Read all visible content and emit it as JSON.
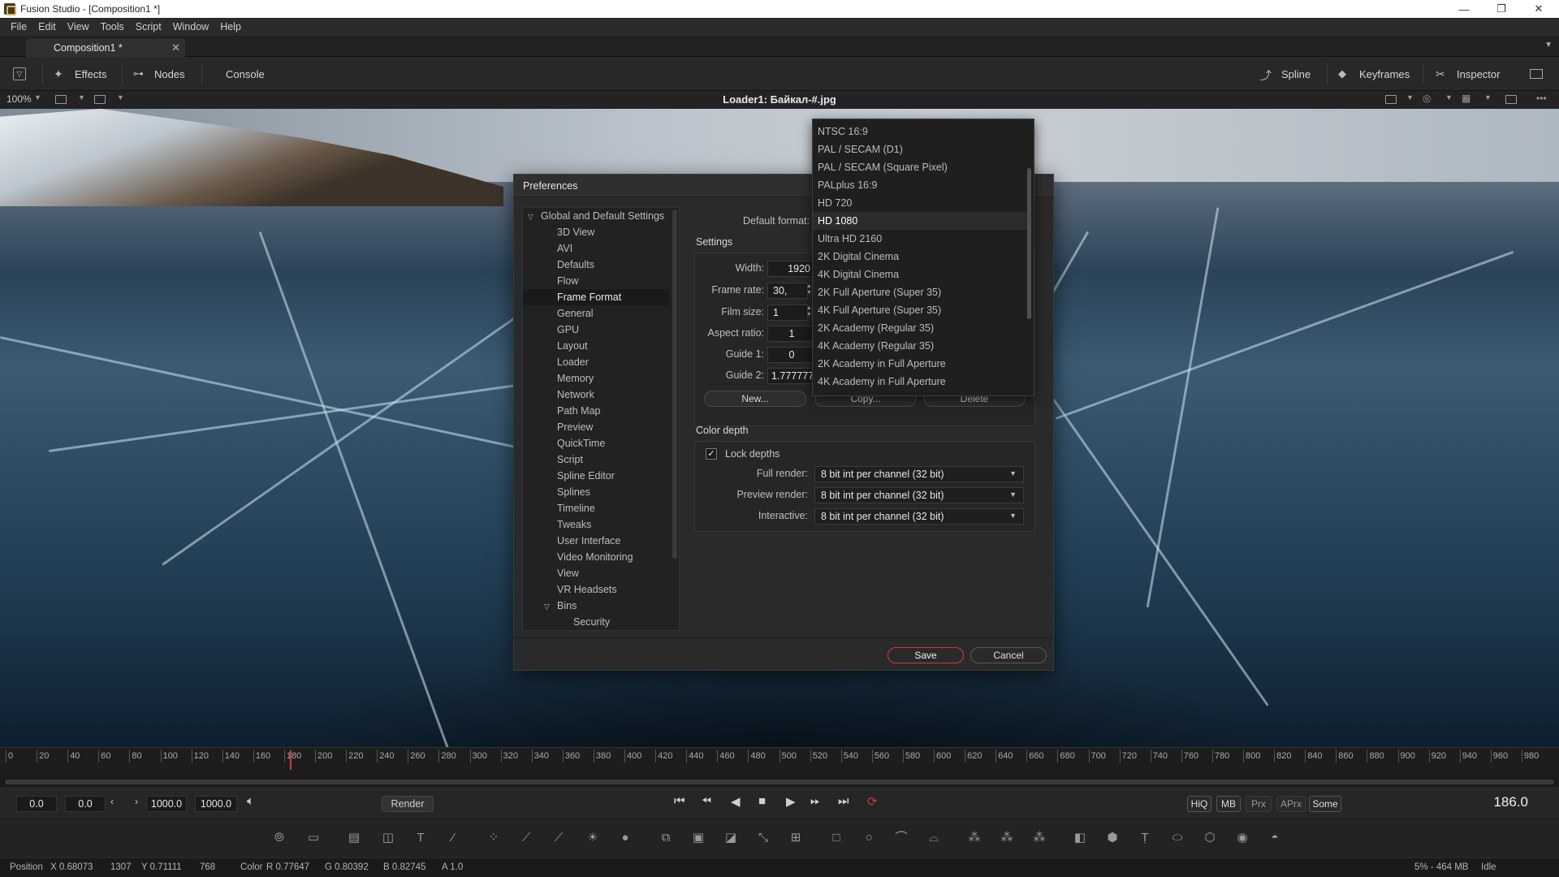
{
  "window": {
    "title": "Fusion Studio - [Composition1 *]",
    "minimize": "—",
    "maximize": "❐",
    "close": "✕"
  },
  "menu": [
    "File",
    "Edit",
    "View",
    "Tools",
    "Script",
    "Window",
    "Help"
  ],
  "tab": {
    "label": "Composition1 *",
    "close": "✕"
  },
  "toolbar": {
    "effects": "Effects",
    "nodes": "Nodes",
    "console": "Console",
    "spline": "Spline",
    "keyframes": "Keyframes",
    "inspector": "Inspector"
  },
  "viewer": {
    "zoom": "100%",
    "title": "Loader1: Байкал-#.jpg"
  },
  "dialog": {
    "title": "Preferences",
    "tree": {
      "root": "Global and Default Settings",
      "items": [
        "3D View",
        "AVI",
        "Defaults",
        "Flow",
        "Frame Format",
        "General",
        "GPU",
        "Layout",
        "Loader",
        "Memory",
        "Network",
        "Path Map",
        "Preview",
        "QuickTime",
        "Script",
        "Spline Editor",
        "Splines",
        "Timeline",
        "Tweaks",
        "User Interface",
        "Video Monitoring",
        "View",
        "VR Headsets"
      ],
      "selected": "Frame Format",
      "bins": "Bins",
      "bins_items": [
        "Security"
      ]
    },
    "default_format_label": "Default format:",
    "settings_label": "Settings",
    "width_label": "Width:",
    "width_value": "1920",
    "framerate_label": "Frame rate:",
    "framerate_value": "30,",
    "filmsize_label": "Film size:",
    "filmsize_value": "1",
    "aspect_label": "Aspect ratio:",
    "aspect_value": "1",
    "guide1_label": "Guide 1:",
    "guide1_value": "0",
    "guide2_label": "Guide 2:",
    "guide2_value": "1.777777",
    "new_button": "New...",
    "copy_button": "Copy...",
    "delete_button": "Delete",
    "color_depth_label": "Color depth",
    "lock_depths_label": "Lock depths",
    "lock_depths_checked": "✓",
    "full_render_label": "Full render:",
    "full_render_value": "8 bit int per channel (32 bit)",
    "preview_render_label": "Preview render:",
    "preview_render_value": "8 bit int per channel (32 bit)",
    "interactive_label": "Interactive:",
    "interactive_value": "8 bit int per channel (32 bit)",
    "save_button": "Save",
    "cancel_button": "Cancel"
  },
  "format_dropdown": {
    "options": [
      "NTSC 16:9",
      "PAL / SECAM (D1)",
      "PAL / SECAM (Square Pixel)",
      "PALplus 16:9",
      "HD 720",
      "HD 1080",
      "Ultra HD 2160",
      "2K Digital Cinema",
      "4K Digital Cinema",
      "2K Full Aperture (Super 35)",
      "4K Full Aperture (Super 35)",
      "2K Academy (Regular 35)",
      "4K Academy (Regular 35)",
      "2K Academy in Full Aperture",
      "4K Academy in Full Aperture"
    ],
    "selected": "HD 1080"
  },
  "timeline": {
    "ticks": [
      "0",
      "20",
      "40",
      "60",
      "80",
      "100",
      "120",
      "140",
      "160",
      "180",
      "200",
      "220",
      "240",
      "260",
      "280",
      "300",
      "320",
      "340",
      "360",
      "380",
      "400",
      "420",
      "440",
      "460",
      "480",
      "500",
      "520",
      "540",
      "560",
      "580",
      "600",
      "620",
      "640",
      "660",
      "680",
      "700",
      "720",
      "740",
      "760",
      "780",
      "800",
      "820",
      "840",
      "860",
      "880",
      "900",
      "920",
      "940",
      "960",
      "980"
    ],
    "current_frame": 186
  },
  "transport": {
    "global_start": "0.0",
    "render_start": "0.0",
    "render_end": "1000.0",
    "global_end": "1000.0",
    "render_button": "Render",
    "hiq": "HiQ",
    "mb": "MB",
    "prx": "Prx",
    "aprx": "APrx",
    "some": "Some",
    "frame_display": "186.0"
  },
  "status": {
    "position_label": "Position",
    "pos_x": "X 0.68073",
    "pos_x_px": "1307",
    "pos_y": "Y 0.71111",
    "pos_y_px": "768",
    "color_label": "Color",
    "r": "R 0.77647",
    "g": "G 0.80392",
    "b": "B 0.82745",
    "a": "A 1.0",
    "memory": "5% - 464 MB",
    "state": "Idle"
  },
  "colors": {
    "accent_red": "#d23a3a",
    "panel": "#2a2a2a",
    "background": "#1b1b1b"
  }
}
